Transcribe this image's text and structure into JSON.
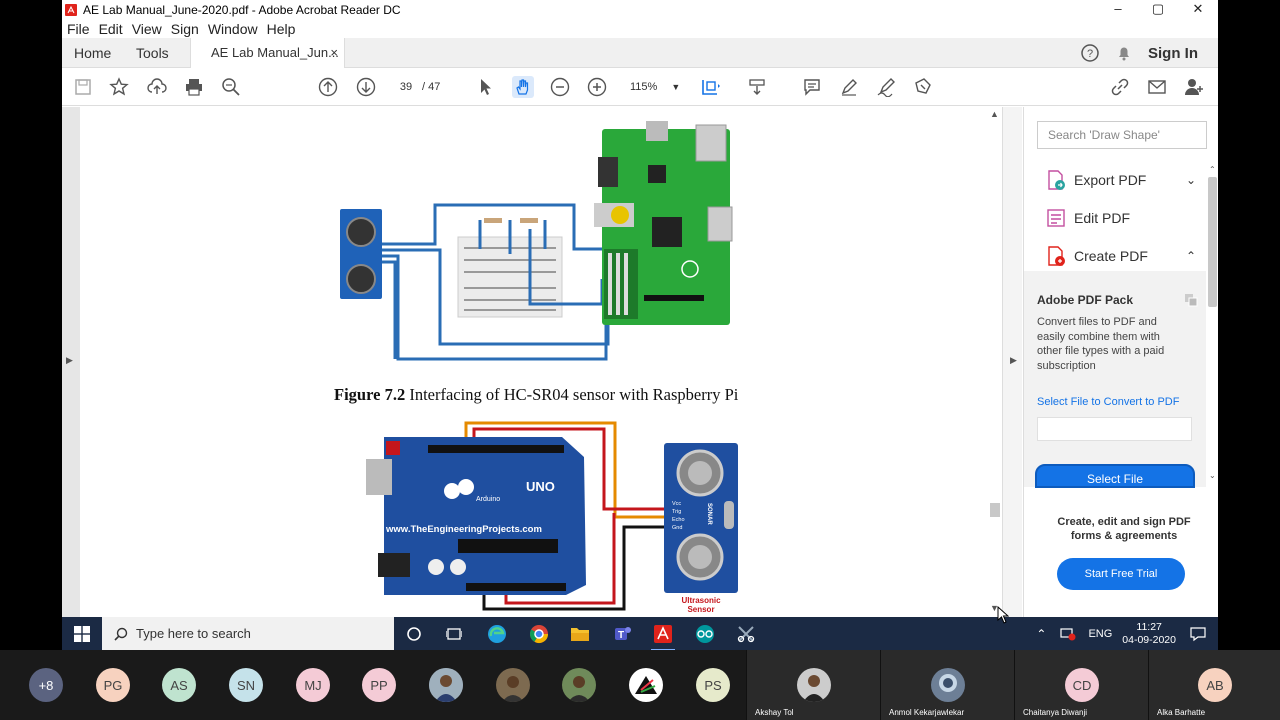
{
  "window": {
    "title": "AE Lab Manual_June-2020.pdf - Adobe Acrobat Reader DC",
    "controls": [
      "–",
      "▢",
      "✕"
    ]
  },
  "menu": [
    "File",
    "Edit",
    "View",
    "Sign",
    "Window",
    "Help"
  ],
  "tabs": {
    "home": "Home",
    "tools": "Tools",
    "document": "AE Lab Manual_Jun...",
    "close": "×",
    "sign_in": "Sign In"
  },
  "toolbar": {
    "current_page": "39",
    "total_pages": "/ 47",
    "zoom": "115%"
  },
  "document": {
    "caption_label": "Figure 7.2",
    "caption_text": " Interfacing of HC-SR04 sensor with Raspberry Pi",
    "arduino_url": "www.TheEngineeringProjects.com",
    "arduino_brand": "UNO",
    "arduino_small": "Arduino",
    "sensor_label_1": "Ultrasonic",
    "sensor_label_2": "Sensor",
    "sensor_side": "SONAR",
    "pins": [
      "Vcc",
      "Trig",
      "Echo",
      "Gnd"
    ]
  },
  "right_panel": {
    "search_placeholder": "Search 'Draw Shape'",
    "items": [
      {
        "label": "Export PDF",
        "chevron": "⌄"
      },
      {
        "label": "Edit PDF",
        "chevron": ""
      },
      {
        "label": "Create PDF",
        "chevron": "⌃"
      }
    ],
    "pack_title": "Adobe PDF Pack",
    "pack_text": "Convert files to PDF and easily combine them with other file types with a paid subscription",
    "pack_link": "Select File to Convert to PDF",
    "select_button": "Select File",
    "promo_text": "Create, edit and sign PDF forms & agreements",
    "trial_button": "Start Free Trial"
  },
  "taskbar": {
    "search_placeholder": "Type here to search",
    "language": "ENG",
    "time": "11:27",
    "date": "04-09-2020"
  },
  "participants": {
    "more": "+8",
    "avatars": [
      "PG",
      "AS",
      "SN",
      "MJ",
      "PP",
      "PS"
    ],
    "tiles": [
      "Akshay Tol",
      "Anmol Kekarjawlekar",
      "Chaitanya Diwanji",
      "Alka Barhatte"
    ],
    "tile_initials": [
      "CD",
      "AB"
    ]
  },
  "colors": {
    "accent": "#1473e6",
    "adobe_red": "#e0231b",
    "taskbar": "#1b2a44"
  }
}
